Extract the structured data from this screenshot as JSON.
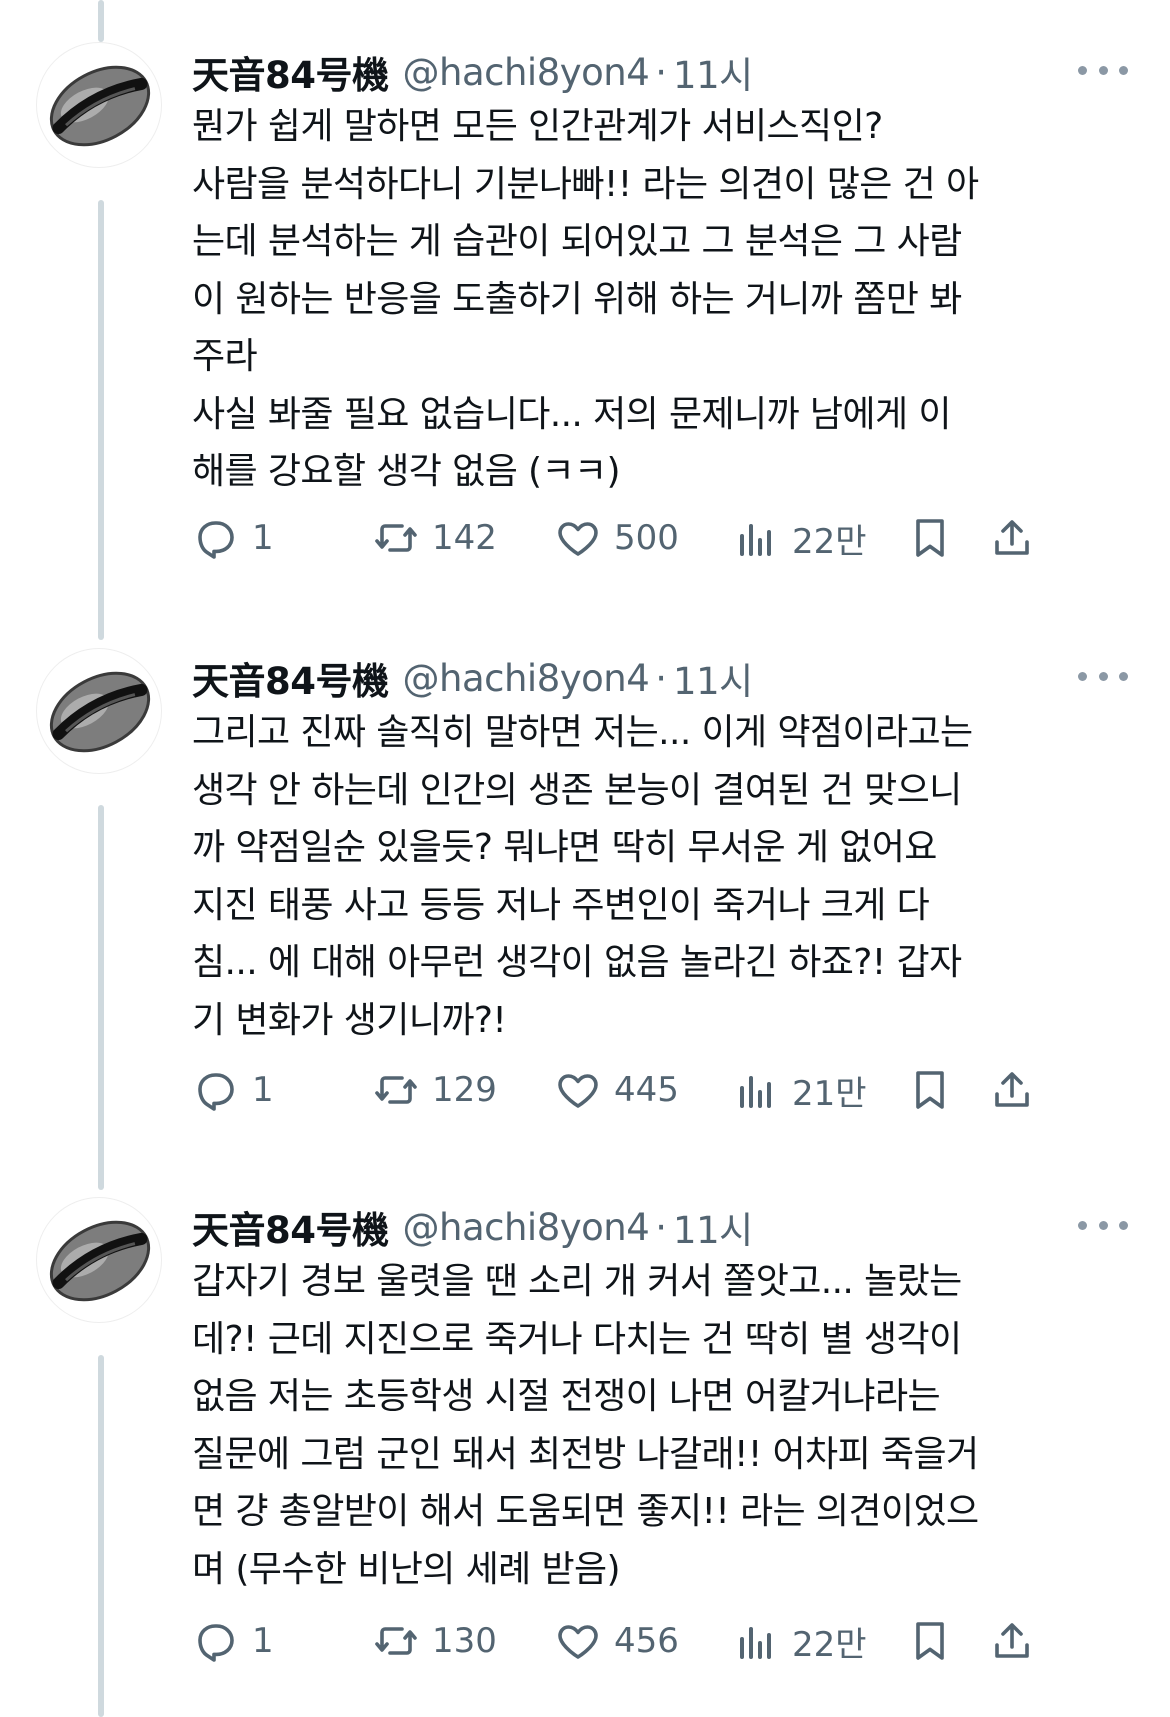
{
  "tweets": [
    {
      "author": {
        "name": "天音84号機",
        "handle": "@hachi8yon4",
        "separator": "·",
        "time": "11시"
      },
      "lines": [
        "뭔가 쉽게 말하면 모든 인간관계가 서비스직인?",
        "사람을 분석하다니 기분나빠!! 라는 의견이 많은 건 아",
        "는데 분석하는 게 습관이 되어있고 그 분석은 그 사람",
        "이 원하는 반응을 도출하기 위해 하는 거니까 쫌만 봐",
        "주라",
        "사실 봐줄 필요 없습니다... 저의 문제니까 남에게 이",
        "해를 강요할 생각 없음 (ㅋㅋ)"
      ],
      "stats": {
        "replies": "1",
        "retweets": "142",
        "likes": "500",
        "views": "22만"
      }
    },
    {
      "author": {
        "name": "天音84号機",
        "handle": "@hachi8yon4",
        "separator": "·",
        "time": "11시"
      },
      "lines": [
        "그리고 진짜 솔직히 말하면 저는... 이게 약점이라고는",
        "생각 안 하는데 인간의 생존 본능이 결여된 건 맞으니",
        "까 약점일순 있을듯? 뭐냐면 딱히 무서운 게 없어요",
        "지진 태풍 사고 등등 저나 주변인이 죽거나 크게 다",
        "침... 에 대해 아무런 생각이 없음 놀라긴 하죠?! 갑자",
        "기 변화가 생기니까?!"
      ],
      "stats": {
        "replies": "1",
        "retweets": "129",
        "likes": "445",
        "views": "21만"
      }
    },
    {
      "author": {
        "name": "天音84号機",
        "handle": "@hachi8yon4",
        "separator": "·",
        "time": "11시"
      },
      "lines": [
        "갑자기 경보 울렷을 땐 소리 개 커서 쫄앗고... 놀랐는",
        "데?! 근데 지진으로 죽거나 다치는 건 딱히 별 생각이",
        "없음 저는 초등학생 시절 전쟁이 나면 어칼거냐라는",
        "질문에 그럼 군인 돼서 최전방 나갈래!! 어차피 죽을거",
        "면 걍 총알받이 해서 도움되면 좋지!! 라는 의견이었으",
        "며 (무수한 비난의 세례 받음)"
      ],
      "stats": {
        "replies": "1",
        "retweets": "130",
        "likes": "456",
        "views": "22만"
      }
    }
  ],
  "icons": {
    "reply": "reply-icon",
    "retweet": "retweet-icon",
    "like": "heart-icon",
    "views": "views-icon",
    "bookmark": "bookmark-icon",
    "share": "share-icon",
    "more": "more-icon"
  },
  "colors": {
    "text": "#0f1419",
    "muted": "#536471",
    "thread_line": "#cfd9de"
  }
}
